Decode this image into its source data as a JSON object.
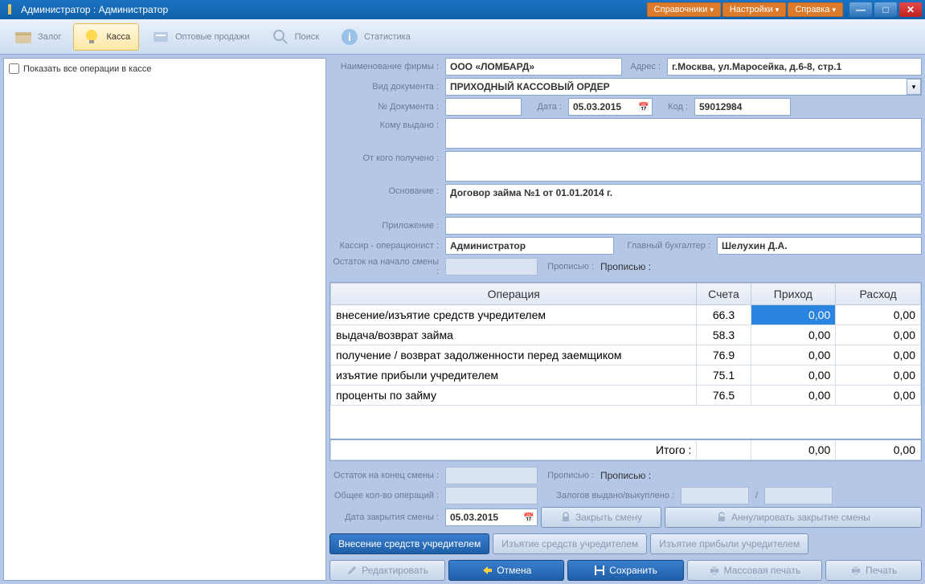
{
  "titlebar": {
    "title": "Администратор : Администратор",
    "menus": [
      "Справочники",
      "Настройки",
      "Справка"
    ]
  },
  "toolbar": {
    "items": [
      {
        "label": "Залог",
        "active": false
      },
      {
        "label": "Касса",
        "active": true
      },
      {
        "label": "Оптовые продажи",
        "active": false
      },
      {
        "label": "Поиск",
        "active": false
      },
      {
        "label": "Статистика",
        "active": false
      }
    ]
  },
  "left": {
    "show_all_label": "Показать все операции в кассе"
  },
  "form": {
    "firm_label": "Наименование фирмы :",
    "firm_value": "ООО «ЛОМБАРД»",
    "addr_label": "Адрес :",
    "addr_value": "г.Москва, ул.Маросейка, д.6-8, стр.1",
    "doctype_label": "Вид документа :",
    "doctype_value": "ПРИХОДНЫЙ КАССОВЫЙ ОРДЕР",
    "docnum_label": "№ Документа :",
    "docnum_value": "",
    "date_label": "Дата :",
    "date_value": "05.03.2015",
    "code_label": "Код :",
    "code_value": "59012984",
    "komu_label": "Кому выдано :",
    "komu_value": "",
    "otkogo_label": "От кого получено :",
    "otkogo_value": "",
    "basis_label": "Основание :",
    "basis_value": "Договор займа №1 от 01.01.2014 г.",
    "app_label": "Приложение :",
    "app_value": "",
    "cashier_label": "Кассир - операционист :",
    "cashier_value": "Администратор",
    "chiefacc_label": "Главный бухгалтер :",
    "chiefacc_value": "Шелухин Д.А.",
    "balance_start_label": "Остаток на начало смены :",
    "propis_start_label": "Прописью :",
    "propis_start_value": "Прописью :",
    "balance_end_label": "Остаток на конец смены :",
    "propis_end_label": "Прописью :",
    "propis_end_value": "Прописью :",
    "opcount_label": "Общее кол-во операций :",
    "zalogs_label": "Залогов выдано/выкуплено :",
    "slash": "/",
    "closedate_label": "Дата закрытия смены :",
    "closedate_value": "05.03.2015"
  },
  "table": {
    "headers": [
      "Операция",
      "Счета",
      "Приход",
      "Расход"
    ],
    "rows": [
      {
        "op": "внесение/изъятие средств учредителем",
        "acct": "66.3",
        "in": "0,00",
        "out": "0,00",
        "edit": true
      },
      {
        "op": "выдача/возврат займа",
        "acct": "58.3",
        "in": "0,00",
        "out": "0,00"
      },
      {
        "op": "получение / возврат задолженности перед заемщиком",
        "acct": "76.9",
        "in": "0,00",
        "out": "0,00"
      },
      {
        "op": "изъятие прибыли учредителем",
        "acct": "75.1",
        "in": "0,00",
        "out": "0,00"
      },
      {
        "op": "проценты по займу",
        "acct": "76.5",
        "in": "0,00",
        "out": "0,00"
      }
    ],
    "total_label": "Итого :",
    "total_in": "0,00",
    "total_out": "0,00"
  },
  "buttons": {
    "close_shift": "Закрыть смену",
    "cancel_close": "Аннулировать закрытие смены",
    "deposit_founder": "Внесение средств учредителем",
    "withdraw_founder": "Изъятие средств учредителем",
    "withdraw_profit": "Изъятие прибыли учредителем",
    "edit": "Редактировать",
    "cancel": "Отмена",
    "save": "Сохранить",
    "mass_print": "Массовая печать",
    "print": "Печать"
  }
}
